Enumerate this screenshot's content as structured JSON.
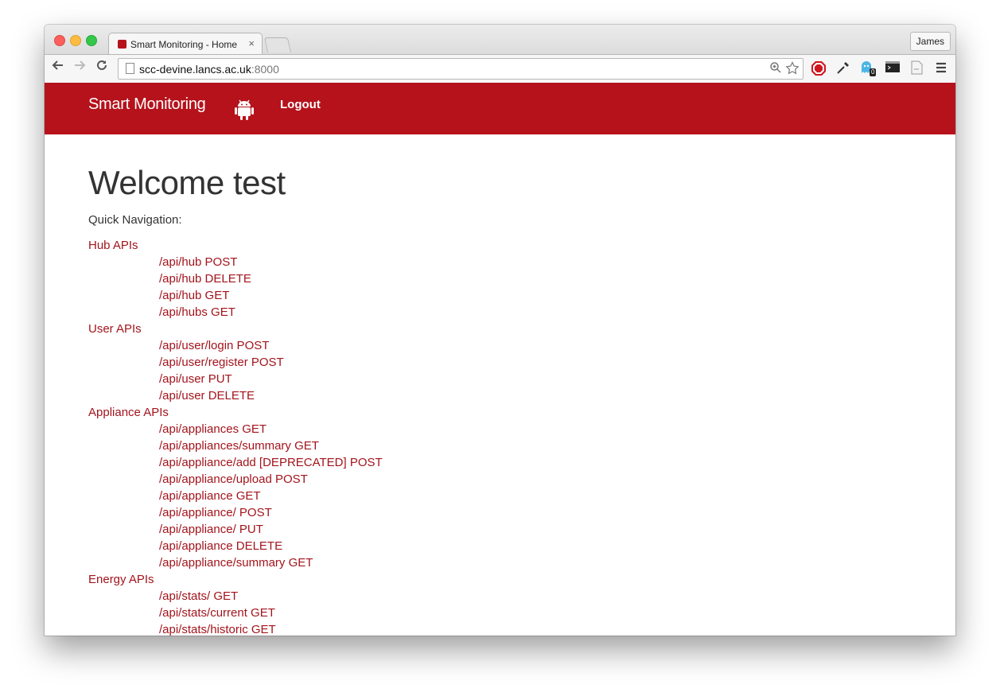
{
  "browser": {
    "tab_title": "Smart Monitoring - Home",
    "tab_close": "×",
    "profile_name": "James",
    "url_host": "scc-devine.lancs.ac.uk",
    "url_port": ":8000",
    "extension_badge": "0",
    "icons": [
      "back-arrow-icon",
      "forward-arrow-icon",
      "reload-icon",
      "page-icon",
      "zoom-icon",
      "bookmark-star-icon",
      "adblock-icon",
      "eyedropper-icon",
      "ghostery-icon",
      "terminal-icon",
      "tex-icon",
      "menu-icon"
    ]
  },
  "site": {
    "brand": "Smart Monitoring",
    "logout": "Logout",
    "brand_color": "#b5121b",
    "link_color": "#a3141c"
  },
  "main": {
    "heading": "Welcome test",
    "quick_nav_label": "Quick Navigation:",
    "groups": [
      {
        "label": "Hub APIs",
        "links": [
          "/api/hub POST",
          "/api/hub DELETE",
          "/api/hub GET",
          "/api/hubs GET"
        ]
      },
      {
        "label": "User APIs",
        "links": [
          "/api/user/login POST",
          "/api/user/register POST",
          "/api/user PUT",
          "/api/user DELETE"
        ]
      },
      {
        "label": "Appliance APIs",
        "links": [
          "/api/appliances GET",
          "/api/appliances/summary GET",
          "/api/appliance/add [DEPRECATED] POST",
          "/api/appliance/upload POST",
          "/api/appliance GET",
          "/api/appliance/ POST",
          "/api/appliance/ PUT",
          "/api/appliance DELETE",
          "/api/appliance/summary GET"
        ]
      },
      {
        "label": "Energy APIs",
        "links": [
          "/api/stats/ GET",
          "/api/stats/current GET",
          "/api/stats/historic GET"
        ]
      }
    ]
  }
}
